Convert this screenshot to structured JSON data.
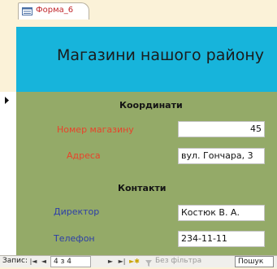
{
  "tab": {
    "title": "Форма_6",
    "icon": "form-icon"
  },
  "form": {
    "title": "Магазини нашого району",
    "sections": {
      "coordinates": "Координати",
      "contacts": "Контакти"
    },
    "fields": {
      "store_number": {
        "label": "Номер магазину",
        "value": "45"
      },
      "address": {
        "label": "Адреса",
        "value": "вул. Гончара, 3"
      },
      "director": {
        "label": "Директор",
        "value": "Костюк В. А."
      },
      "phone": {
        "label": "Телефон",
        "value": "234-11-11"
      }
    }
  },
  "colors": {
    "header_band": "#17b4db",
    "detail_band": "#94aa68",
    "background": "#fbf2d8",
    "label_red": "#e8432b",
    "label_blue": "#2c3ea8"
  },
  "navbar": {
    "record_label": "Запис:",
    "first": "|◄",
    "prev": "◄",
    "position": "4 з 4",
    "next": "►",
    "last": "►|",
    "new": "►✱",
    "filter_icon": "funnel-icon",
    "filter_status": "Без фільтра",
    "search": "Пошук"
  }
}
